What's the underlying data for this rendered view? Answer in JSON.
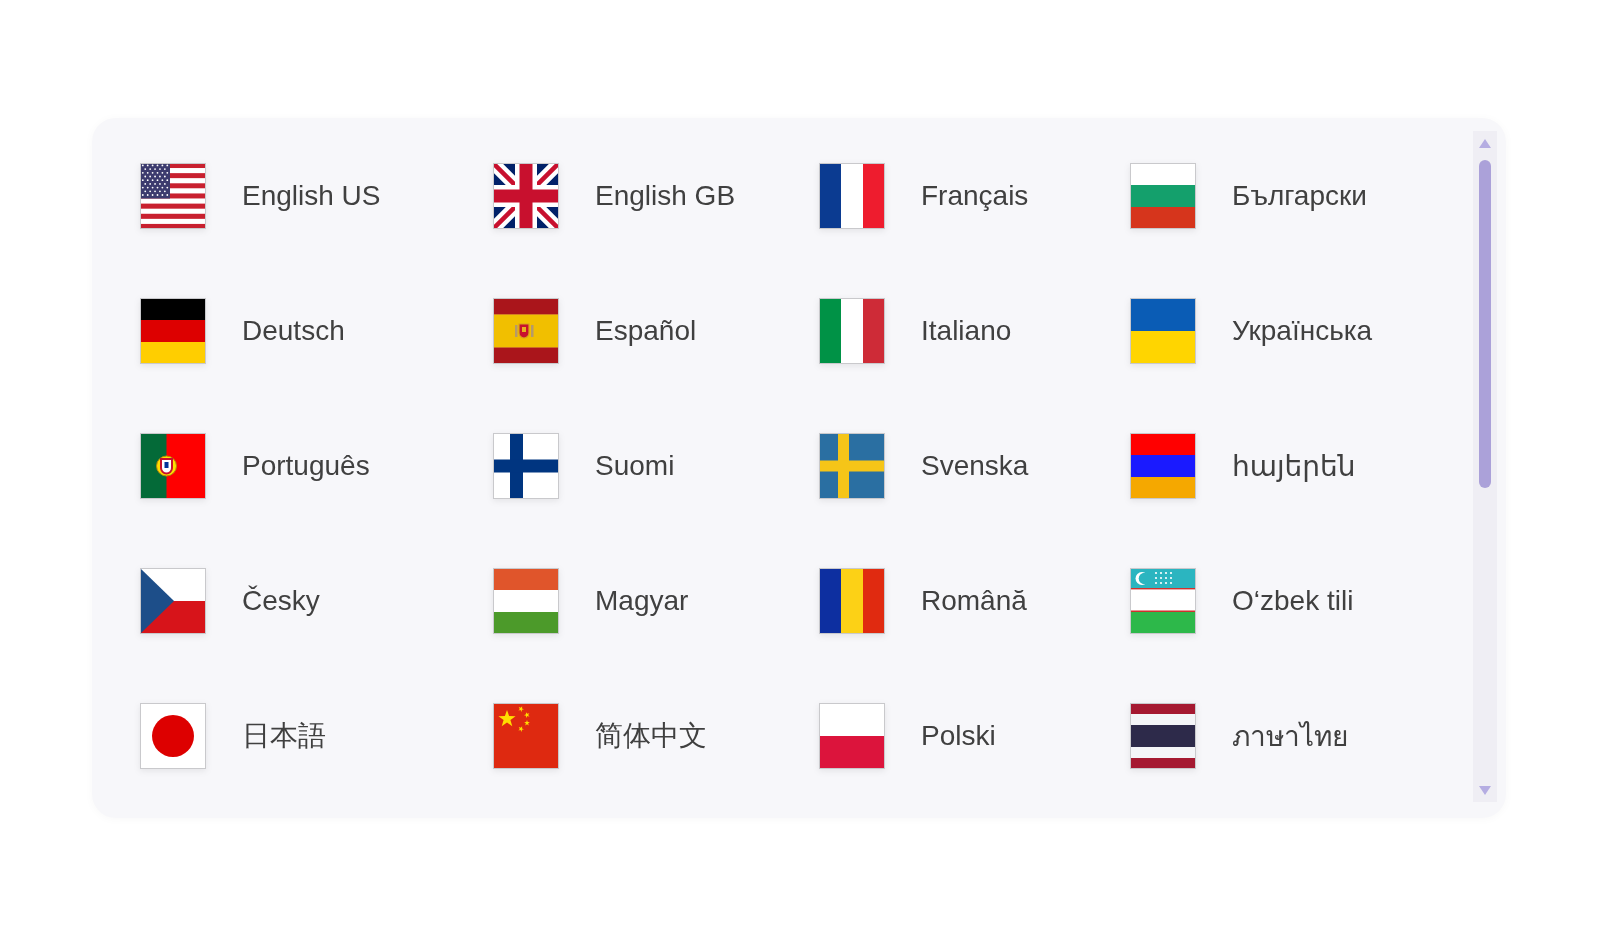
{
  "languages": [
    {
      "label": "English US",
      "kind": "us"
    },
    {
      "label": "English GB",
      "kind": "gb"
    },
    {
      "label": "Français",
      "kind": "fr"
    },
    {
      "label": "Български",
      "kind": "bg"
    },
    {
      "label": "Deutsch",
      "kind": "de"
    },
    {
      "label": "Español",
      "kind": "es"
    },
    {
      "label": "Italiano",
      "kind": "it"
    },
    {
      "label": "Українська",
      "kind": "ua"
    },
    {
      "label": "Português",
      "kind": "pt"
    },
    {
      "label": "Suomi",
      "kind": "fi"
    },
    {
      "label": "Svenska",
      "kind": "se"
    },
    {
      "label": "հայերեն",
      "kind": "am"
    },
    {
      "label": "Česky",
      "kind": "cz"
    },
    {
      "label": "Magyar",
      "kind": "hu"
    },
    {
      "label": "Română",
      "kind": "ro"
    },
    {
      "label": "O‘zbek tili",
      "kind": "uz"
    },
    {
      "label": "日本語",
      "kind": "jp"
    },
    {
      "label": "简体中文",
      "kind": "cn"
    },
    {
      "label": "Polski",
      "kind": "pl"
    },
    {
      "label": "ภาษาไทย",
      "kind": "th"
    }
  ]
}
